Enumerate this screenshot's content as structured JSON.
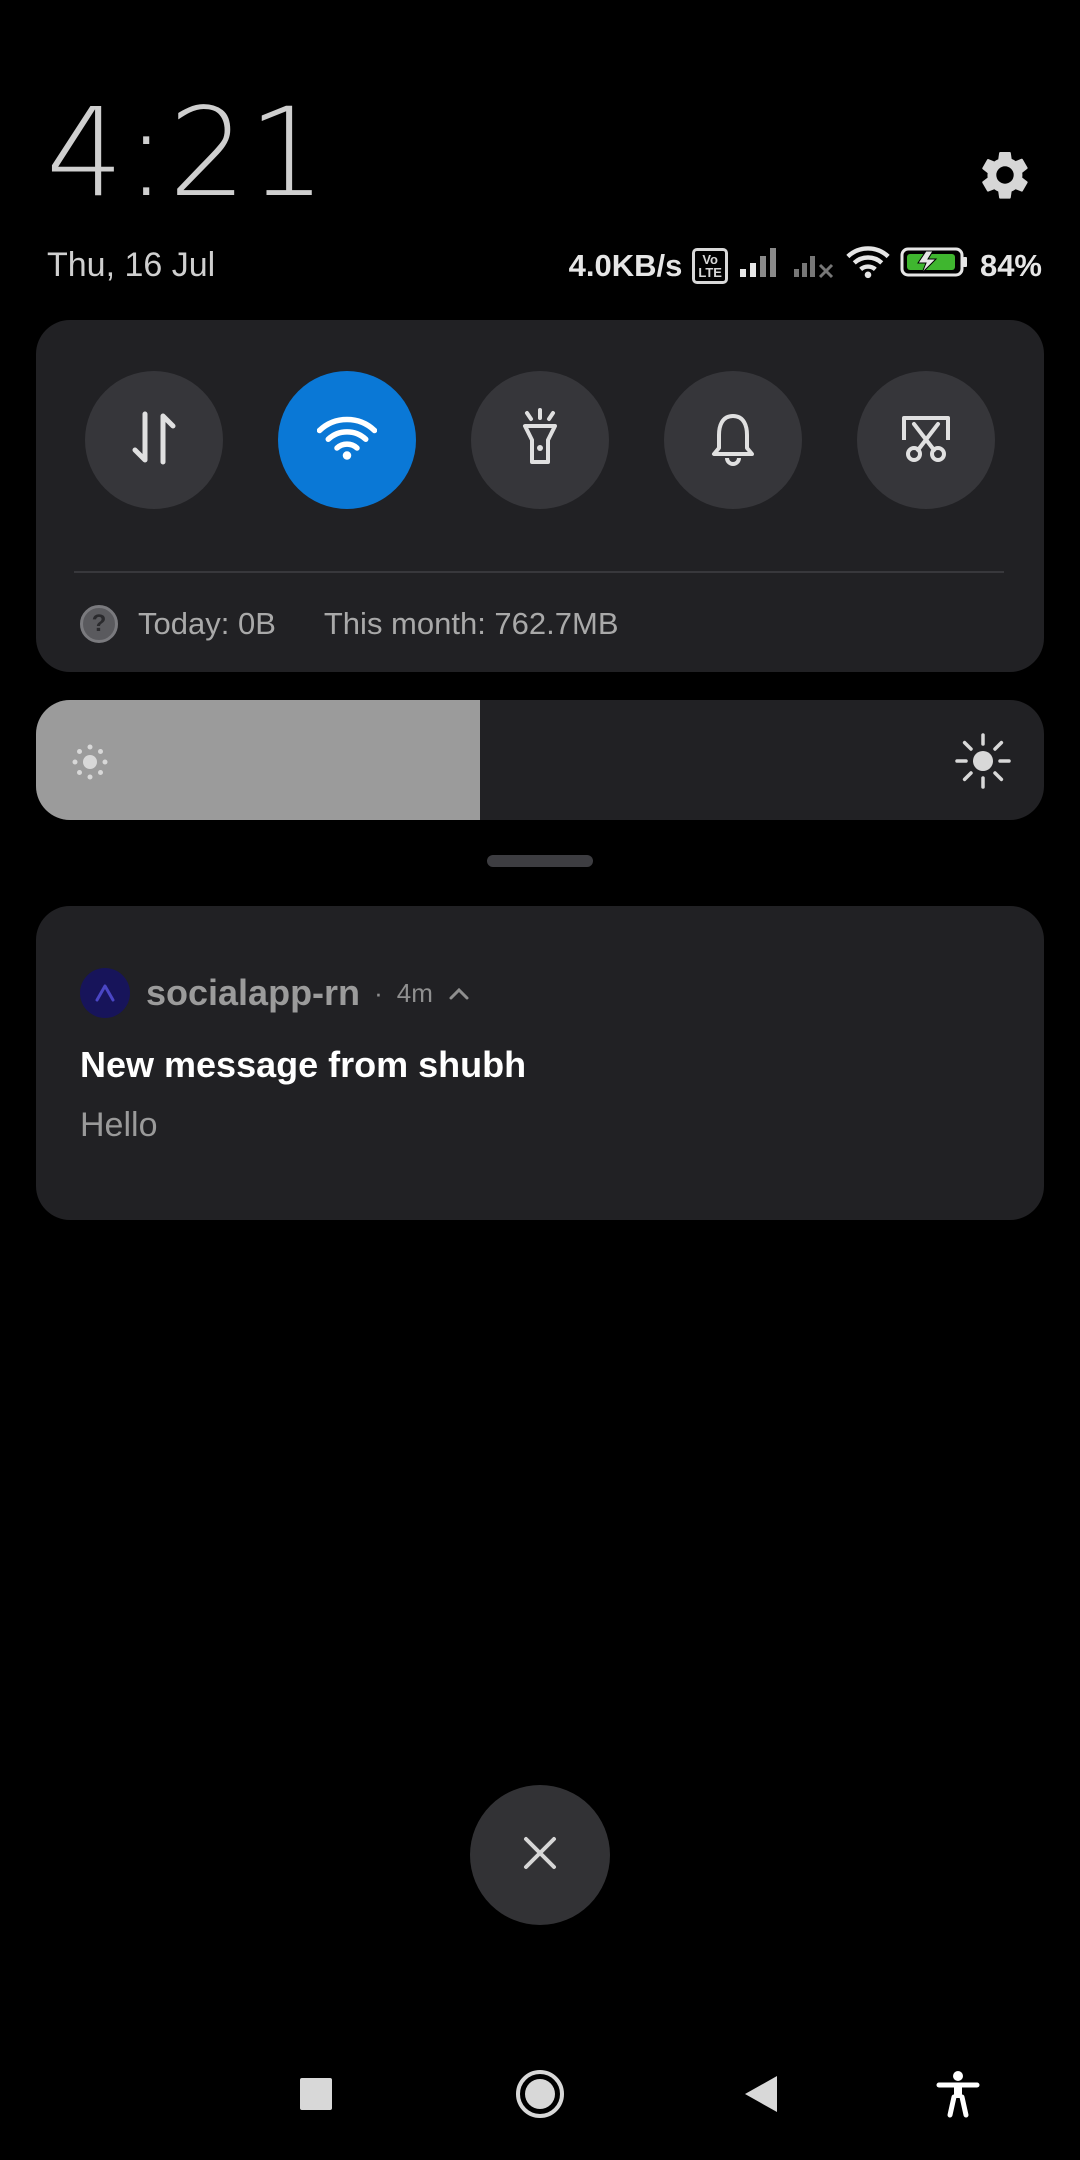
{
  "header": {
    "time": "4:21",
    "date": "Thu, 16 Jul"
  },
  "status": {
    "net_speed": "4.0KB/s",
    "volte_top": "Vo",
    "volte_bottom": "LTE",
    "battery_percent": "84%"
  },
  "quick_settings": {
    "tiles": [
      "mobile-data-icon",
      "wifi-icon",
      "flashlight-icon",
      "bell-icon",
      "screenshot-icon"
    ],
    "active_tile": "wifi-icon",
    "accent": "#0a78d6",
    "data_usage": {
      "help": "?",
      "today": "Today: 0B",
      "month": "This month: 762.7MB"
    }
  },
  "brightness": {
    "level": 0.44
  },
  "notification": {
    "app_name": "socialapp-rn",
    "separator": "·",
    "age": "4m",
    "title": "New message from shubh",
    "body": "Hello"
  }
}
